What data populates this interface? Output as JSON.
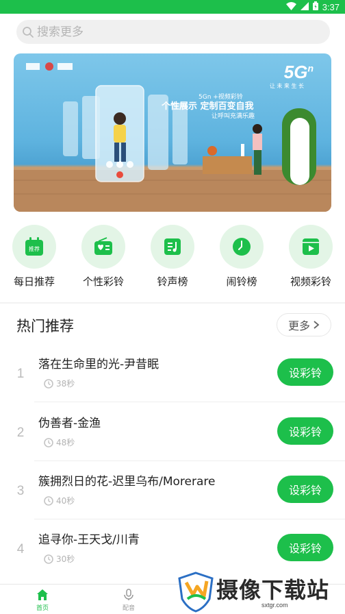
{
  "status_bar": {
    "time": "3:37",
    "bg_color": "#1dbf4b"
  },
  "search": {
    "placeholder": "搜索更多",
    "icon": "search-icon"
  },
  "banner": {
    "brand_5g": "5G",
    "brand_5g_sup": "n",
    "brand_5g_sub": "让 未 来 生 长",
    "subtitle": "5Gn +视频彩铃",
    "headline": "个性展示  定制百变自我",
    "tagline": "让呼叫充满乐趣"
  },
  "categories": [
    {
      "label": "每日推荐",
      "icon": "calendar-recommend-icon",
      "badge": "推荐"
    },
    {
      "label": "个性彩铃",
      "icon": "radio-icon"
    },
    {
      "label": "铃声榜",
      "icon": "music-list-icon"
    },
    {
      "label": "闹铃榜",
      "icon": "clock-icon"
    },
    {
      "label": "视频彩铃",
      "icon": "video-icon"
    }
  ],
  "hot": {
    "title": "热门推荐",
    "more_label": "更多",
    "items": [
      {
        "index": "1",
        "title": "落在生命里的光-尹昔眠",
        "duration": "38秒",
        "action": "设彩铃"
      },
      {
        "index": "2",
        "title": "伪善者-金渔",
        "duration": "48秒",
        "action": "设彩铃"
      },
      {
        "index": "3",
        "title": "簇拥烈日的花-迟里乌布/Morerare",
        "duration": "40秒",
        "action": "设彩铃"
      },
      {
        "index": "4",
        "title": "追寻你-王天戈/川青",
        "duration": "30秒",
        "action": "设彩铃"
      }
    ]
  },
  "bottom_nav": [
    {
      "label": "首页",
      "icon": "home-icon",
      "active": true
    },
    {
      "label": "配音",
      "icon": "microphone-icon",
      "active": false
    }
  ],
  "watermark": {
    "text": "摄像下载站",
    "url": "sxtgr.com"
  },
  "colors": {
    "accent": "#1dbf4b",
    "accent_light": "#e3f5e6"
  }
}
